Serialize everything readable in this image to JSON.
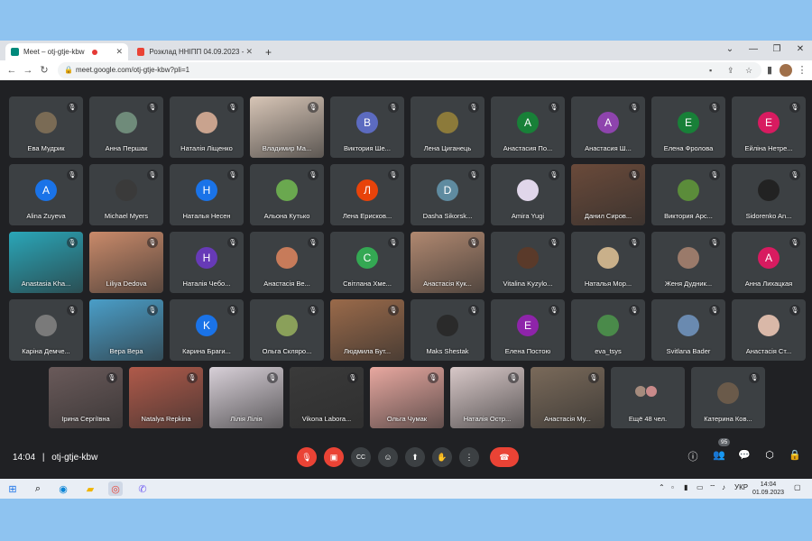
{
  "browser": {
    "tabs": [
      {
        "label": "Meet – otj-gtje-kbw"
      },
      {
        "label": "Розклад ННІПП 04.09.2023 - ex"
      }
    ],
    "url": "meet.google.com/otj-gtje-kbw?pli=1"
  },
  "participants_row1": [
    {
      "name": "Ева Мудрик",
      "avatar": "photo",
      "color": "#7a6b55"
    },
    {
      "name": "Анна Першак",
      "avatar": "photo",
      "color": "#6f8b7a"
    },
    {
      "name": "Наталія Ліщенко",
      "avatar": "photo",
      "color": "#c9a38e"
    },
    {
      "name": "Владимир Ма...",
      "avatar": "video",
      "color": "#d7c5b6"
    },
    {
      "name": "Виктория Ше...",
      "avatar": "B",
      "color": "#5c6bc0"
    },
    {
      "name": "Лена Циганець",
      "avatar": "photo",
      "color": "#8c7a3a"
    },
    {
      "name": "Анастасия По...",
      "avatar": "A",
      "color": "#188038"
    },
    {
      "name": "Анастасия Ш...",
      "avatar": "A",
      "color": "#8e44ad"
    },
    {
      "name": "Елена Фролова",
      "avatar": "E",
      "color": "#188038"
    },
    {
      "name": "Ейліна Нетре...",
      "avatar": "E",
      "color": "#d81b60"
    }
  ],
  "participants_row2": [
    {
      "name": "Alina Zuyeva",
      "avatar": "A",
      "color": "#1a73e8"
    },
    {
      "name": "Michael Myers",
      "avatar": "photo",
      "color": "#3a3a3a"
    },
    {
      "name": "Наталья Несен",
      "avatar": "H",
      "color": "#1a73e8"
    },
    {
      "name": "Альона Кутько",
      "avatar": "photo",
      "color": "#6aa84f"
    },
    {
      "name": "Лена Ерисков...",
      "avatar": "Л",
      "color": "#e8430a"
    },
    {
      "name": "Dasha Sikorsk...",
      "avatar": "D",
      "color": "#5f8ba0"
    },
    {
      "name": "Amira Yugi",
      "avatar": "photo",
      "color": "#e0d6ea"
    },
    {
      "name": "Данил Сиров...",
      "avatar": "video",
      "color": "#6a4a3a"
    },
    {
      "name": "Виктория Арс...",
      "avatar": "photo",
      "color": "#5b8c3a"
    },
    {
      "name": "Sidorenko An...",
      "avatar": "photo",
      "color": "#222222"
    }
  ],
  "participants_row3": [
    {
      "name": "Anastasia Kha...",
      "avatar": "video",
      "color": "#2aa6b8"
    },
    {
      "name": "Liliya Dedova",
      "avatar": "video",
      "color": "#c98a6a"
    },
    {
      "name": "Наталія Чебо...",
      "avatar": "H",
      "color": "#673ab7"
    },
    {
      "name": "Анастасія Ве...",
      "avatar": "photo",
      "color": "#c77b5a"
    },
    {
      "name": "Світлана Хме...",
      "avatar": "C",
      "color": "#34a853"
    },
    {
      "name": "Анастасія Кук...",
      "avatar": "video",
      "color": "#b08870"
    },
    {
      "name": "Vitalina Kyzylo...",
      "avatar": "photo",
      "color": "#5a3a2a"
    },
    {
      "name": "Наталья Мор...",
      "avatar": "photo",
      "color": "#c9b08a"
    },
    {
      "name": "Женя Дудник...",
      "avatar": "photo",
      "color": "#9a7a6a"
    },
    {
      "name": "Анна Лихацкая",
      "avatar": "A",
      "color": "#d81b60"
    }
  ],
  "participants_row4": [
    {
      "name": "Каріна Демче...",
      "avatar": "photo",
      "color": "#7a7a7a"
    },
    {
      "name": "Вера Вера",
      "avatar": "video",
      "color": "#4a9ec8"
    },
    {
      "name": "Карина Браги...",
      "avatar": "K",
      "color": "#1a73e8"
    },
    {
      "name": "Ольга Скляро...",
      "avatar": "photo",
      "color": "#8aa05a"
    },
    {
      "name": "Людмила Бут...",
      "avatar": "video",
      "color": "#9a6a4a"
    },
    {
      "name": "Maks Shestak",
      "avatar": "photo",
      "color": "#2a2a2a"
    },
    {
      "name": "Елена Постою",
      "avatar": "E",
      "color": "#8e24aa"
    },
    {
      "name": "eva_tsys",
      "avatar": "photo",
      "color": "#4a8a4a"
    },
    {
      "name": "Svitlana Bader",
      "avatar": "photo",
      "color": "#6a8ab0"
    },
    {
      "name": "Анастасія Ст...",
      "avatar": "photo",
      "color": "#d9b8a8"
    }
  ],
  "participants_row5": [
    {
      "name": "Ірина Сергіївна",
      "avatar": "video",
      "color": "#6a5a5a"
    },
    {
      "name": "Natalya Repkina",
      "avatar": "video",
      "color": "#b05a4a"
    },
    {
      "name": "Лілія Лілія",
      "avatar": "video",
      "color": "#d8d0d8"
    },
    {
      "name": "Vikona Labora...",
      "avatar": "video",
      "color": "#3a3a3a"
    },
    {
      "name": "Ольга Чумак",
      "avatar": "video",
      "color": "#e8a8a0"
    },
    {
      "name": "Наталія Остр...",
      "avatar": "video",
      "color": "#d8c8c8"
    },
    {
      "name": "Анастасія Му...",
      "avatar": "video",
      "color": "#7a6a5a"
    }
  ],
  "more_tile": {
    "label": "Ещё 48 чел."
  },
  "last_tile": {
    "name": "Катерина Ков...",
    "avatar": "photo",
    "color": "#6a5a4a"
  },
  "bottom": {
    "time": "14:04",
    "meeting_code": "otj-gtje-kbw",
    "participants_count": "95"
  },
  "taskbar": {
    "time": "14:04",
    "date": "01.09.2023",
    "lang": "УКР"
  }
}
